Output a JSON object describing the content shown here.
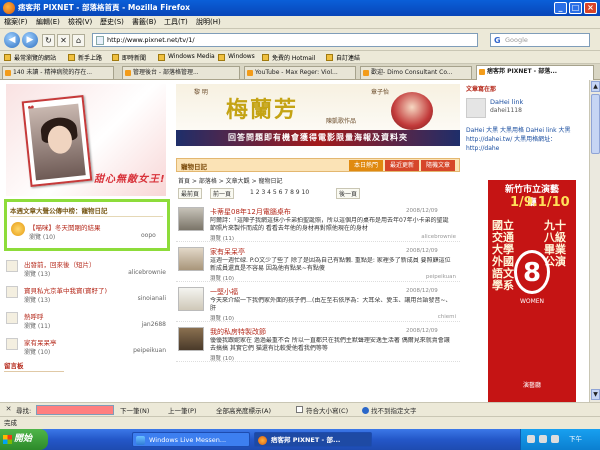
{
  "window": {
    "title": "痞客邦 PIXNET - 部落格首頁 - Mozilla Firefox",
    "min": "_",
    "max": "□",
    "close": "×"
  },
  "menu": [
    "檔案(F)",
    "編輯(E)",
    "檢視(V)",
    "歷史(S)",
    "書籤(B)",
    "工具(T)",
    "說明(H)"
  ],
  "nav": {
    "back": "◀",
    "forward": "▶",
    "reload": "↻",
    "stop": "✕",
    "home": "⌂",
    "url": "http://www.pixnet.net/tv/1/",
    "search_placeholder": "Google",
    "search_g": "G"
  },
  "bookmarks": [
    "最常瀏覽的網站",
    "新手上路",
    "即時新聞",
    "Windows Media",
    "Windows",
    "免費的 Hotmail",
    "自訂連結"
  ],
  "tabs": [
    {
      "label": "140 未讀 - 精神病院的存在..."
    },
    {
      "label": "管理後台 - 部落格管理..."
    },
    {
      "label": "YouTube - Max Reger: Viol..."
    },
    {
      "label": "歡迎- Dimo Consultant Co..."
    },
    {
      "label": "痞客邦 PIXNET - 部落...",
      "active": true
    }
  ],
  "left": {
    "slogan": "甜心無敵女王!",
    "popular_title": "本週文章大聲公傳中榜：寵物日記",
    "popular_post": "【喵咪】冬天鬨睏的結果",
    "popular_meta": "瀏覽 (10)",
    "popular_author": "oopo",
    "items": [
      {
        "title": "出發前，回來後（短片）",
        "meta": "瀏覽 (13)",
        "author": "alicebrownie"
      },
      {
        "title": "寶貝私亢京革中我寶(寶籽了)",
        "meta": "瀏覽 (13)",
        "author": "sinoianali"
      },
      {
        "title": "熱呼呼",
        "meta": "瀏覽 (11)",
        "author": "jan2688"
      },
      {
        "title": "家有呆呆亭",
        "meta": "瀏覽 (10)",
        "author": "peipeikuan"
      }
    ],
    "guestbook": "留言板"
  },
  "banner": {
    "left_name": "黎 明",
    "right_name": "章子怡",
    "main": "梅蘭芳",
    "sub": "陳凱歌作品",
    "red": "回答問題即有機會獲得電影限量海報及資料夾"
  },
  "section": {
    "label": "寵物日記",
    "tabs": [
      "本日熱門",
      "最近更新",
      "隨機文章"
    ]
  },
  "crumb": "首頁 > 部落格 > 文章大觀 > 寵物日記",
  "pager": {
    "first": "最前頁",
    "prev": "前一頁",
    "nums": "1 2 3 4 5 6 7 8 9 10",
    "next": "後一頁"
  },
  "posts": [
    {
      "title": "卡蒂星08年12月電腦桌布",
      "date": "2008/12/09",
      "text": "阿爾詩：「這陣子我網這抹小卡弟拍聖誕照，所以這個月的桌布是用去年07年小卡弟的聖誕節照片來製作而成的 看看去年他的身材再對照他現在的身材",
      "meta": "瀏覽 (11)",
      "author": "alicebrownie"
    },
    {
      "title": "家有呆呆亭",
      "date": "2008/12/09",
      "text": "這週一週忙碌. P.O文少了些了 除了是因為自己有點懶. 重點是: 家裡多了新成員 要照顧這位新成員還真是不容易 因為他有點呆~有點傻",
      "meta": "瀏覽 (10)",
      "author": "peipeikuan"
    },
    {
      "title": "一堅小福",
      "date": "2008/12/09",
      "text": "今天來介紹一下我們家外面的孩子們…(由左至右依序為：大耳朵、愛玉、讓用台語發音~、肝",
      "meta": "瀏覽 (10)",
      "author": "chiemi"
    },
    {
      "title": "我的私房特製改節",
      "date": "2008/12/09",
      "text": "優優我跟妮家在 過過最重不合 所以一直都只在我們主默聲理安逸生活著 偶爾見來就賣會讓去搞搞 其實它們 猫還有比較愛他看我們等等",
      "meta": "瀏覽 (10)",
      "author": ""
    }
  ],
  "right": {
    "header": "文章寫在那",
    "name": "DaHei link",
    "id": "dahei1118",
    "desc": "DaHei 大黑 大黑用格 DaHei link 大黑 http://dahei.tw/ 大黑用格網址：http://dahe"
  },
  "ad": {
    "h1": "新竹市立演藝廳",
    "h2": "1/9.1/10",
    "v1": "國立交通大學外國語文學系",
    "v2": "九十八級畢業公演",
    "eight": "8",
    "wm": "WOMEN",
    "foot": "演藝廳"
  },
  "find": {
    "close": "✕",
    "label": "尋找:",
    "next": "下一筆(N)",
    "prev": "上一筆(P)",
    "highlight": "全部高亮度標示(A)",
    "case": "符合大小寫(C)",
    "notfound": "找不到指定文字"
  },
  "status": "完成",
  "taskbar": {
    "start": "開始",
    "tasks": [
      "Windows Live Messen...",
      "痞客邦 PIXNET - 部..."
    ],
    "time": "下午 07:33"
  }
}
